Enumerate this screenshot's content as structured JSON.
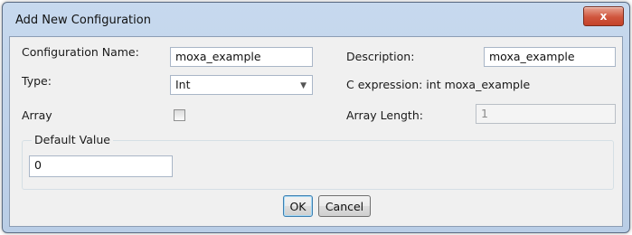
{
  "window": {
    "title": "Add New Configuration",
    "close_label": "x"
  },
  "form": {
    "name_label": "Configuration Name:",
    "name_value": "moxa_example",
    "description_label": "Description:",
    "description_value": "moxa_example",
    "type_label": "Type:",
    "type_value": "Int",
    "c_expression": "C expression: int moxa_example",
    "array_label": "Array",
    "array_checked": false,
    "array_length_label": "Array Length:",
    "array_length_value": "1",
    "default_group_title": "Default Value",
    "default_value": "0"
  },
  "buttons": {
    "ok": "OK",
    "cancel": "Cancel"
  }
}
